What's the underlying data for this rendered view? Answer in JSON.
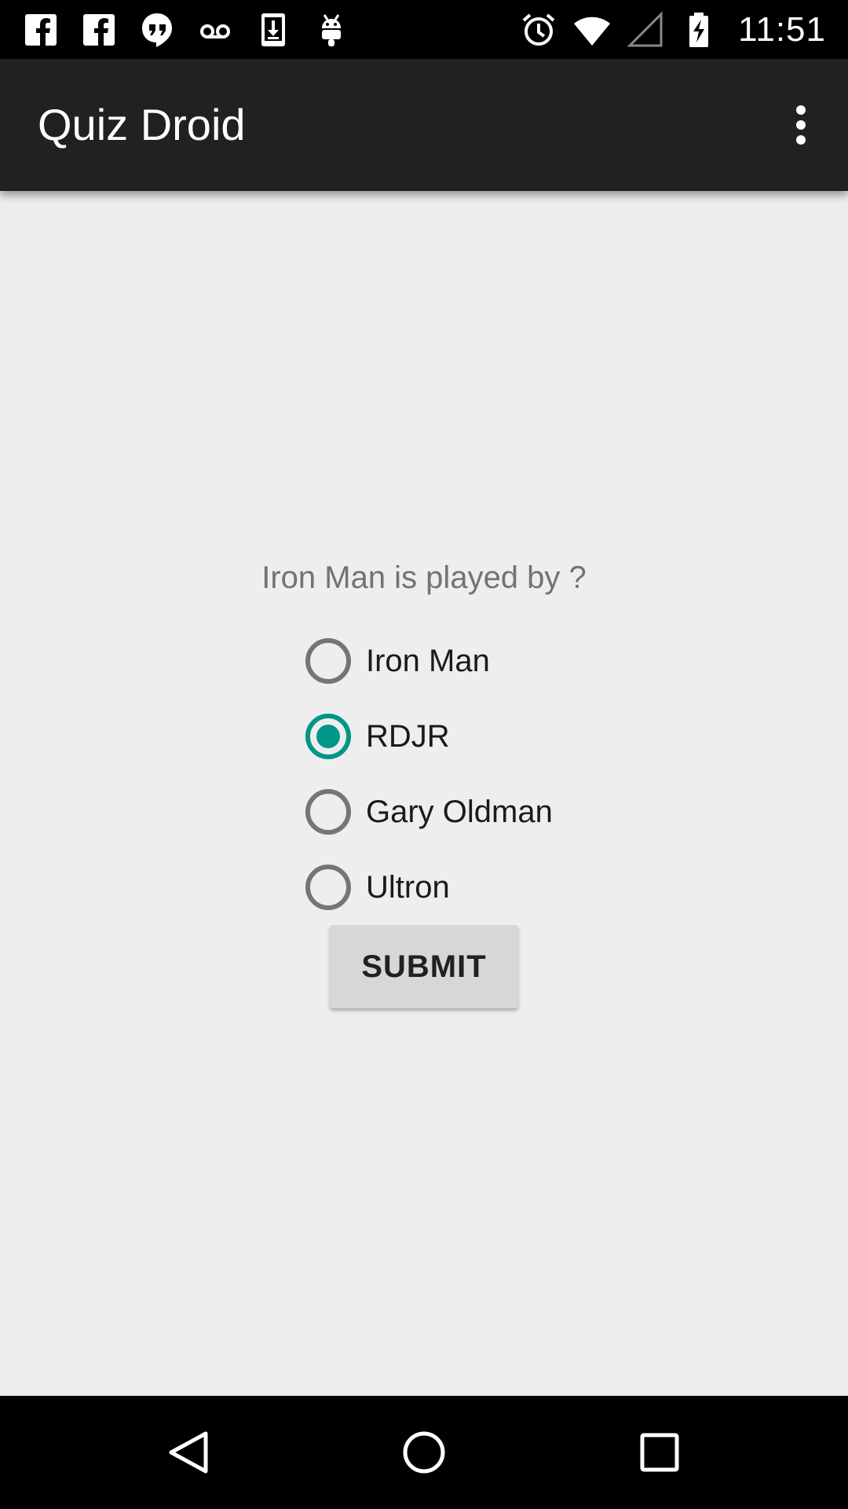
{
  "status_bar": {
    "time": "11:51",
    "left_icons": [
      "facebook-icon",
      "facebook-icon",
      "hangouts-icon",
      "voicemail-icon",
      "download-icon",
      "android-icon"
    ],
    "right_icons": [
      "alarm-icon",
      "wifi-icon",
      "signal-icon",
      "battery-charging-icon"
    ]
  },
  "action_bar": {
    "title": "Quiz Droid",
    "overflow_icon": "more-vert-icon"
  },
  "quiz": {
    "question": "Iron Man is played by ?",
    "options": [
      {
        "label": "Iron Man",
        "selected": false
      },
      {
        "label": "RDJR",
        "selected": true
      },
      {
        "label": "Gary Oldman",
        "selected": false
      },
      {
        "label": "Ultron",
        "selected": false
      }
    ],
    "submit_label": "SUBMIT"
  },
  "colors": {
    "accent": "#009688",
    "radio_unchecked": "#757575",
    "toolbar": "#212121",
    "background": "#eeeeee",
    "button": "#d6d7d7"
  },
  "nav_bar": {
    "buttons": [
      "back-icon",
      "home-icon",
      "recents-icon"
    ]
  }
}
